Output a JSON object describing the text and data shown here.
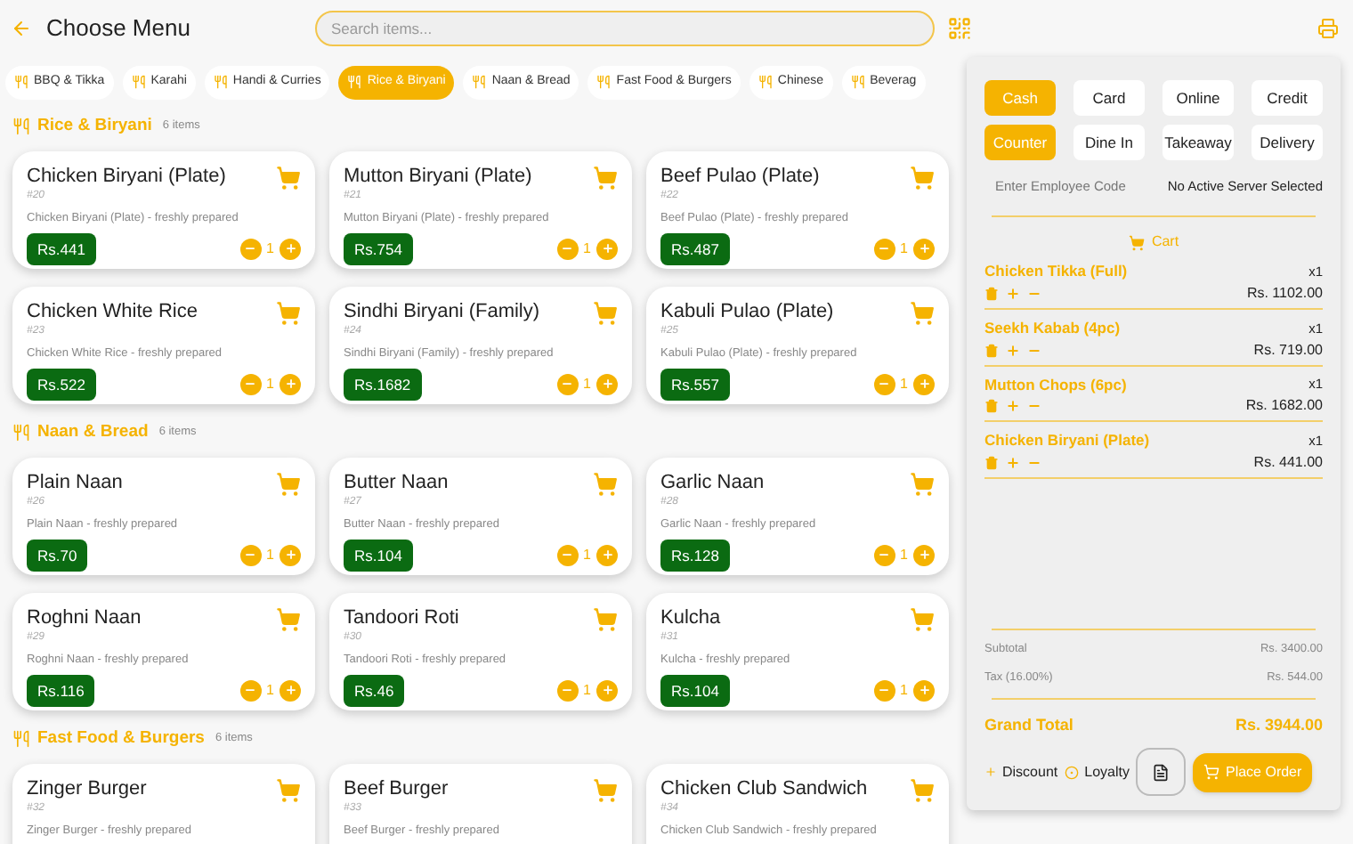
{
  "header": {
    "title": "Choose Menu",
    "search": {
      "placeholder": "Search items..."
    }
  },
  "categories": [
    {
      "label": "BBQ & Tikka",
      "selected": false
    },
    {
      "label": "Karahi",
      "selected": false
    },
    {
      "label": "Handi & Curries",
      "selected": false
    },
    {
      "label": "Rice & Biryani",
      "selected": true
    },
    {
      "label": "Naan & Bread",
      "selected": false
    },
    {
      "label": "Fast Food & Burgers",
      "selected": false
    },
    {
      "label": "Chinese",
      "selected": false
    },
    {
      "label": "Beverag",
      "selected": false
    }
  ],
  "sections": [
    {
      "title": "Rice & Biryani",
      "count": "6 items",
      "items": [
        {
          "name": "Chicken Biryani (Plate)",
          "code": "#20",
          "description": "Chicken Biryani (Plate) - freshly prepared",
          "price": "Rs.441",
          "qty": "1"
        },
        {
          "name": "Mutton Biryani (Plate)",
          "code": "#21",
          "description": "Mutton Biryani (Plate) - freshly prepared",
          "price": "Rs.754",
          "qty": "1"
        },
        {
          "name": "Beef Pulao (Plate)",
          "code": "#22",
          "description": "Beef Pulao (Plate) - freshly prepared",
          "price": "Rs.487",
          "qty": "1"
        },
        {
          "name": "Chicken White Rice",
          "code": "#23",
          "description": "Chicken White Rice - freshly prepared",
          "price": "Rs.522",
          "qty": "1"
        },
        {
          "name": "Sindhi Biryani (Family)",
          "code": "#24",
          "description": "Sindhi Biryani (Family) - freshly prepared",
          "price": "Rs.1682",
          "qty": "1"
        },
        {
          "name": "Kabuli Pulao (Plate)",
          "code": "#25",
          "description": "Kabuli Pulao (Plate) - freshly prepared",
          "price": "Rs.557",
          "qty": "1"
        }
      ]
    },
    {
      "title": "Naan & Bread",
      "count": "6 items",
      "items": [
        {
          "name": "Plain Naan",
          "code": "#26",
          "description": "Plain Naan - freshly prepared",
          "price": "Rs.70",
          "qty": "1"
        },
        {
          "name": "Butter Naan",
          "code": "#27",
          "description": "Butter Naan - freshly prepared",
          "price": "Rs.104",
          "qty": "1"
        },
        {
          "name": "Garlic Naan",
          "code": "#28",
          "description": "Garlic Naan - freshly prepared",
          "price": "Rs.128",
          "qty": "1"
        },
        {
          "name": "Roghni Naan",
          "code": "#29",
          "description": "Roghni Naan - freshly prepared",
          "price": "Rs.116",
          "qty": "1"
        },
        {
          "name": "Tandoori Roti",
          "code": "#30",
          "description": "Tandoori Roti - freshly prepared",
          "price": "Rs.46",
          "qty": "1"
        },
        {
          "name": "Kulcha",
          "code": "#31",
          "description": "Kulcha - freshly prepared",
          "price": "Rs.104",
          "qty": "1"
        }
      ]
    },
    {
      "title": "Fast Food & Burgers",
      "count": "6 items",
      "items": [
        {
          "name": "Zinger Burger",
          "code": "#32",
          "description": "Zinger Burger - freshly prepared"
        },
        {
          "name": "Beef Burger",
          "code": "#33",
          "description": "Beef Burger - freshly prepared"
        },
        {
          "name": "Chicken Club Sandwich",
          "code": "#34",
          "description": "Chicken Club Sandwich - freshly prepared"
        }
      ]
    }
  ],
  "order": {
    "payment_methods": [
      {
        "label": "Cash",
        "selected": true
      },
      {
        "label": "Card",
        "selected": false
      },
      {
        "label": "Online",
        "selected": false
      },
      {
        "label": "Credit",
        "selected": false
      }
    ],
    "order_types": [
      {
        "label": "Counter",
        "selected": true
      },
      {
        "label": "Dine In",
        "selected": false
      },
      {
        "label": "Takeaway",
        "selected": false
      },
      {
        "label": "Delivery",
        "selected": false
      }
    ],
    "employee_code": {
      "placeholder": "Enter Employee Code"
    },
    "server_status": "No Active Server Selected",
    "cart_title": "Cart",
    "cart_items": [
      {
        "name": "Chicken Tikka (Full)",
        "qty": "x1",
        "price": "Rs. 1102.00"
      },
      {
        "name": "Seekh Kabab (4pc)",
        "qty": "x1",
        "price": "Rs. 719.00"
      },
      {
        "name": "Mutton Chops (6pc)",
        "qty": "x1",
        "price": "Rs. 1682.00"
      },
      {
        "name": "Chicken Biryani (Plate)",
        "qty": "x1",
        "price": "Rs. 441.00"
      }
    ],
    "subtotal": {
      "label": "Subtotal",
      "value": "Rs. 3400.00"
    },
    "tax": {
      "label": "Tax (16.00%)",
      "value": "Rs. 544.00"
    },
    "grand_total": {
      "label": "Grand Total",
      "value": "Rs. 3944.00"
    },
    "discount": "Discount",
    "loyalty": "Loyalty",
    "place_order": "Place Order"
  }
}
